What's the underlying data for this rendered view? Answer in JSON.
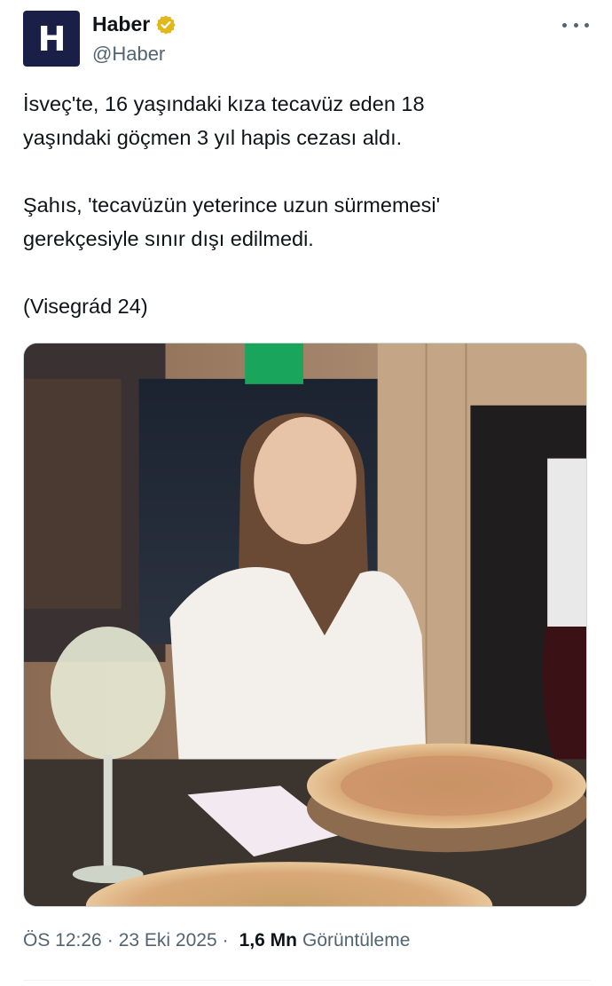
{
  "author": {
    "display_name": "Haber",
    "handle": "@Haber",
    "avatar_letter": "H",
    "avatar_color": "#1a1f47",
    "verified": true,
    "verified_color": "#e2b719"
  },
  "tweet": {
    "paragraphs": [
      "İsveç'te, 16 yaşındaki kıza tecavüz eden 18\nyaşındaki göçmen 3 yıl hapis cezası aldı.",
      "Şahıs, 'tecavüzün yeterince uzun sürmemesi'\ngerekçesiyle sınır dışı edilmedi.",
      "(Visegrád 24)"
    ]
  },
  "media": {
    "icon": "photo",
    "description_icon": "restaurant-photo"
  },
  "meta": {
    "time": "ÖS 12:26",
    "date": "23 Eki 2025",
    "views_count": "1,6 Mn",
    "views_label": "Görüntüleme"
  },
  "colors": {
    "text": "#0f1419",
    "secondary": "#536471",
    "border": "#cfd9de"
  }
}
